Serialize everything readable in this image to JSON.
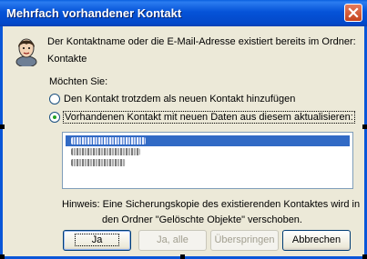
{
  "window": {
    "title": "Mehrfach vorhandener Kontakt",
    "close_icon": "close-icon"
  },
  "message": {
    "line1": "Der Kontaktname oder die E-Mail-Adresse existiert bereits im Ordner:",
    "line2": "Kontakte"
  },
  "question": "Möchten Sie:",
  "options": [
    {
      "label": "Den Kontakt trotzdem als neuen Kontakt hinzufügen",
      "selected": false
    },
    {
      "label": "Vorhandenen Kontakt mit neuen Daten aus diesem aktualisieren:",
      "selected": true
    }
  ],
  "hint": {
    "line1": "Hinweis: Eine Sicherungskopie des existierenden Kontaktes wird in",
    "line2": "den Ordner \"Gelöschte Objekte\" verschoben."
  },
  "buttons": {
    "yes": "Ja",
    "yes_all": "Ja, alle",
    "skip": "Überspringen",
    "cancel": "Abbrechen"
  },
  "colors": {
    "title_bar": "#0553d8",
    "accent": "#316ac5",
    "dialog_bg": "#ece9d8"
  }
}
